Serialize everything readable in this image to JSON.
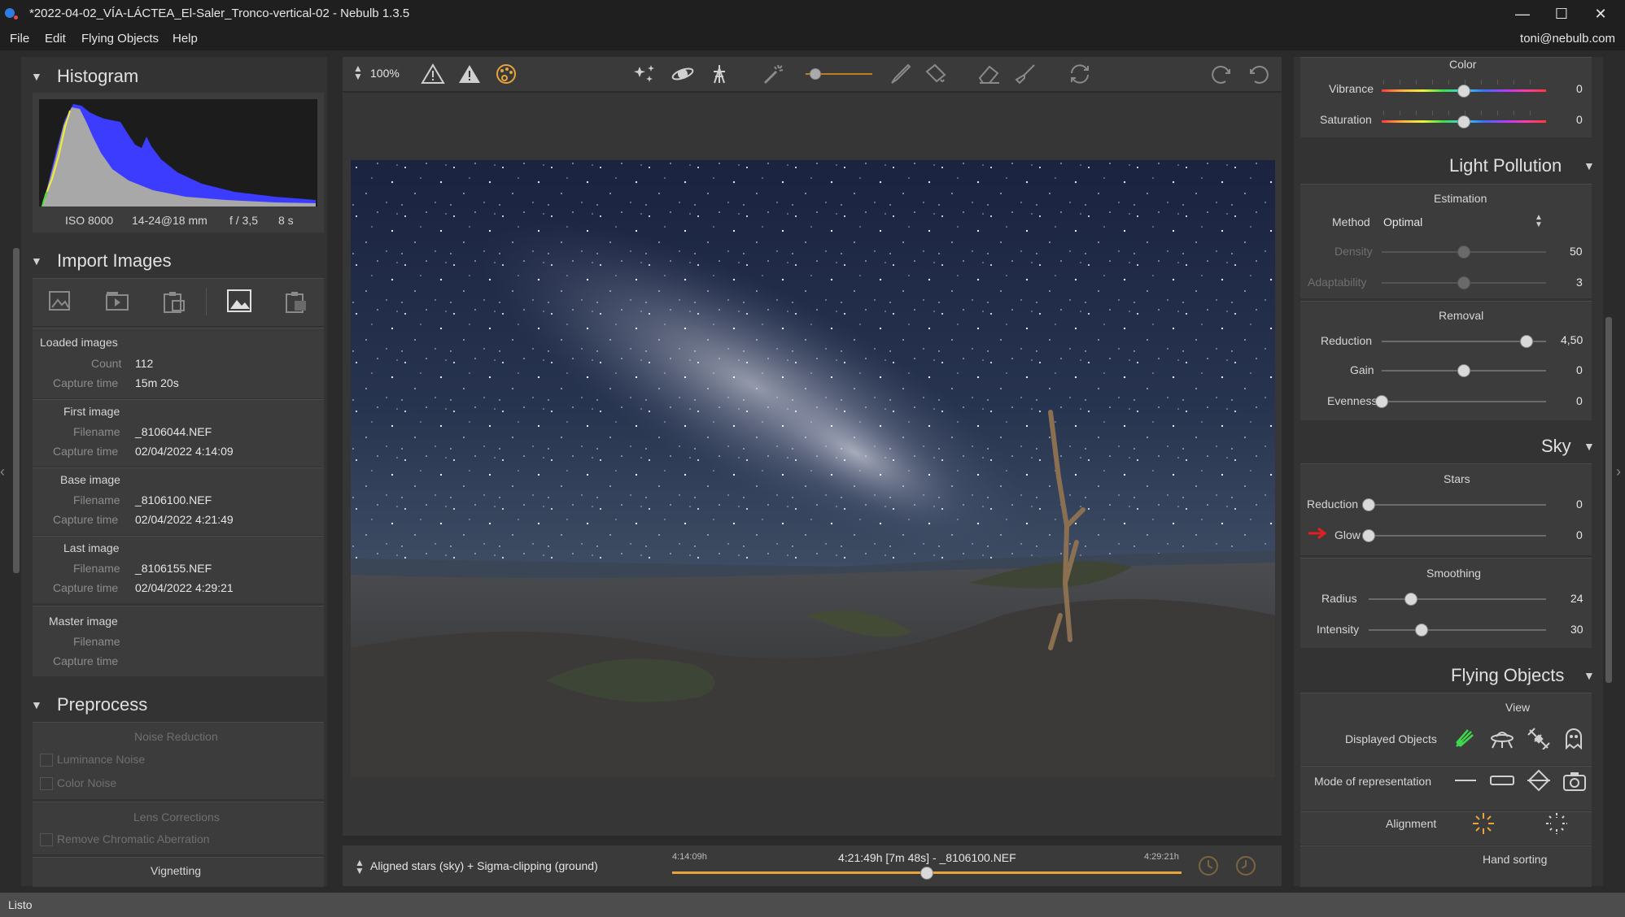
{
  "titlebar": {
    "title": "*2022-04-02_VÍA-LÁCTEA_El-Saler_Tronco-vertical-02 - Nebulb 1.3.5",
    "minimize": "—",
    "maximize": "☐",
    "close": "✕"
  },
  "menu": {
    "items": [
      "File",
      "Edit",
      "Flying Objects",
      "Help"
    ],
    "user": "toni@nebulb.com"
  },
  "histogram": {
    "title": "Histogram",
    "iso": "ISO 8000",
    "lens": "14-24@18 mm",
    "aperture": "f / 3,5",
    "exposure": "8 s"
  },
  "import": {
    "title": "Import Images",
    "loaded": {
      "heading": "Loaded images",
      "count_label": "Count",
      "count": "112",
      "capture_label": "Capture time",
      "capture": "15m 20s"
    },
    "first": {
      "heading": "First image",
      "filename_label": "Filename",
      "filename": "_8106044.NEF",
      "capture_label": "Capture time",
      "capture": "02/04/2022 4:14:09"
    },
    "base": {
      "heading": "Base image",
      "filename_label": "Filename",
      "filename": "_8106100.NEF",
      "capture_label": "Capture time",
      "capture": "02/04/2022 4:21:49"
    },
    "last": {
      "heading": "Last image",
      "filename_label": "Filename",
      "filename": "_8106155.NEF",
      "capture_label": "Capture time",
      "capture": "02/04/2022 4:29:21"
    },
    "master": {
      "heading": "Master image",
      "filename_label": "Filename",
      "capture_label": "Capture time"
    }
  },
  "preprocess": {
    "title": "Preprocess",
    "noise": {
      "heading": "Noise Reduction",
      "luminance": "Luminance Noise",
      "color": "Color Noise"
    },
    "lens": {
      "heading": "Lens Corrections",
      "chromatic": "Remove Chromatic Aberration"
    },
    "vignetting": "Vignetting"
  },
  "toolbar": {
    "zoom": "100%"
  },
  "bottom": {
    "mode": "Aligned stars (sky) + Sigma-clipping (ground)",
    "start_time": "4:14:09h",
    "current": "4:21:49h [7m 48s] - _8106100.NEF",
    "end_time": "4:29:21h",
    "timeline_position": 0.5
  },
  "color": {
    "heading": "Color",
    "vibrance": {
      "label": "Vibrance",
      "value": "0",
      "level": 0.5
    },
    "saturation": {
      "label": "Saturation",
      "value": "0",
      "level": 0.5
    }
  },
  "light_pollution": {
    "title": "Light Pollution",
    "estimation": "Estimation",
    "method_label": "Method",
    "method_value": "Optimal",
    "density": {
      "label": "Density",
      "value": "50",
      "level": 0.5
    },
    "adaptability": {
      "label": "Adaptability",
      "value": "3",
      "level": 0.5
    },
    "removal": "Removal",
    "reduction": {
      "label": "Reduction",
      "value": "4,50",
      "level": 0.88
    },
    "gain": {
      "label": "Gain",
      "value": "0",
      "level": 0.5
    },
    "evenness": {
      "label": "Evenness",
      "value": "0",
      "level": 0.0
    }
  },
  "sky": {
    "title": "Sky",
    "stars": "Stars",
    "reduction": {
      "label": "Reduction",
      "value": "0",
      "level": 0.0
    },
    "glow": {
      "label": "Glow",
      "value": "0",
      "level": 0.0
    },
    "smoothing": "Smoothing",
    "radius": {
      "label": "Radius",
      "value": "24",
      "level": 0.24
    },
    "intensity": {
      "label": "Intensity",
      "value": "30",
      "level": 0.3
    }
  },
  "flying": {
    "title": "Flying Objects",
    "view": "View",
    "displayed": "Displayed Objects",
    "mode": "Mode of representation",
    "alignment": "Alignment",
    "hand_sorting": "Hand sorting"
  },
  "status": {
    "text": "Listo"
  },
  "colors": {
    "accent_orange": "#e8a43a",
    "arrow_red": "#e02020",
    "meteor_green": "#3fd84a"
  }
}
